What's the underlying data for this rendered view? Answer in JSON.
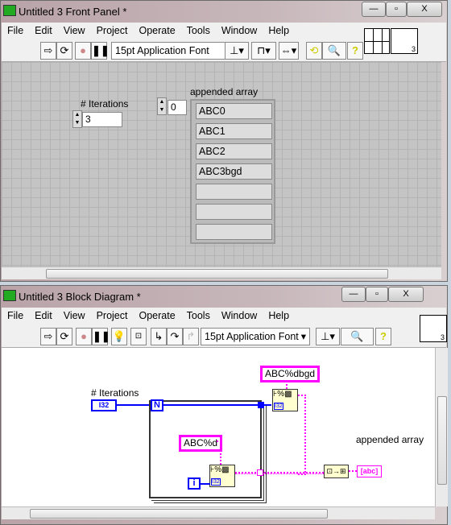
{
  "front_panel": {
    "title": "Untitled 3 Front Panel *",
    "menu": [
      "File",
      "Edit",
      "View",
      "Project",
      "Operate",
      "Tools",
      "Window",
      "Help"
    ],
    "font": "15pt Application Font",
    "iterations_label": "# Iterations",
    "iterations_value": "3",
    "array_label": "appended array",
    "array_index": "0",
    "array_values": [
      "ABC0",
      "ABC1",
      "ABC2",
      "ABC3bgd",
      "",
      "",
      ""
    ],
    "connector_number": "3"
  },
  "block_diagram": {
    "title": "Untitled 3 Block Diagram *",
    "menu": [
      "File",
      "Edit",
      "View",
      "Project",
      "Operate",
      "Tools",
      "Window",
      "Help"
    ],
    "font": "15pt Application Font",
    "iterations_label": "# Iterations",
    "iterations_type": "I32",
    "loop_count": "N",
    "loop_index": "i",
    "format_inner": "ABC%d",
    "format_outer": "ABC%dbgd",
    "indicator_label": "appended array",
    "indicator_type": "abc",
    "node_type": "I32",
    "connector_number": "3"
  },
  "colors": {
    "string_wire": "#ff00ff",
    "int_wire": "#0000ff",
    "node": "#ffffd0"
  }
}
